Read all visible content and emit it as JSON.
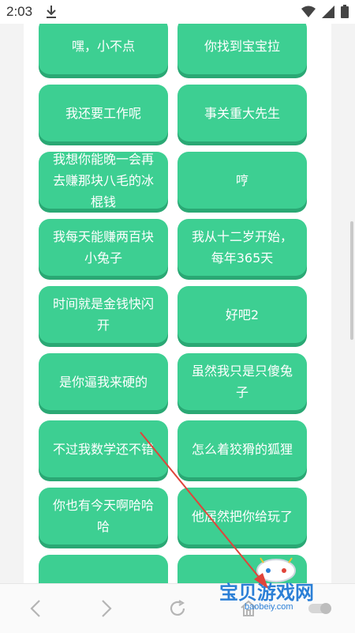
{
  "status": {
    "time": "2:03"
  },
  "buttons": [
    {
      "label": "嘿，小不点"
    },
    {
      "label": "你找到宝宝拉"
    },
    {
      "label": "我还要工作呢"
    },
    {
      "label": "事关重大先生"
    },
    {
      "label": "我想你能晚一会再去赚那块八毛的冰棍钱"
    },
    {
      "label": "哼"
    },
    {
      "label": "我每天能赚两百块小兔子"
    },
    {
      "label": "我从十二岁开始，每年365天"
    },
    {
      "label": "时间就是金钱快闪开"
    },
    {
      "label": "好吧2"
    },
    {
      "label": "是你逼我来硬的"
    },
    {
      "label": "虽然我只是只傻兔子"
    },
    {
      "label": "不过我数学还不错"
    },
    {
      "label": "怎么着狡猾的狐狸"
    },
    {
      "label": "你也有今天啊哈哈哈"
    },
    {
      "label": "他居然把你给玩了"
    },
    {
      "label": ""
    },
    {
      "label": ""
    }
  ],
  "watermark": {
    "text": "宝贝游戏网",
    "url": "baobeiy.com"
  },
  "icons": {
    "download": "download-icon",
    "wifi": "wifi-icon",
    "signal": "signal-icon",
    "battery": "battery-icon",
    "back": "back-icon",
    "forward": "forward-icon",
    "refresh": "refresh-icon",
    "home": "home-icon",
    "toggle": "toggle-icon"
  },
  "colors": {
    "button": "#3dcf92",
    "button_shadow": "#2aa874",
    "arrow": "#e0443a",
    "watermark": "#2b7fd6"
  }
}
